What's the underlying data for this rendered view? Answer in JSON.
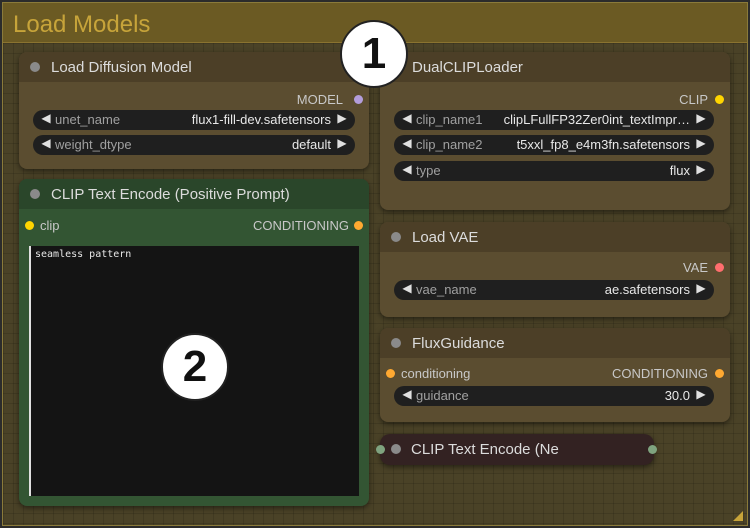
{
  "group": {
    "title": "Load Models"
  },
  "nodes": {
    "load_diffusion": {
      "title": "Load Diffusion Model",
      "output_label": "MODEL",
      "widgets": [
        {
          "label": "unet_name",
          "value": "flux1-fill-dev.safetensors"
        },
        {
          "label": "weight_dtype",
          "value": "default"
        }
      ]
    },
    "dual_clip": {
      "title": "DualCLIPLoader",
      "output_label": "CLIP",
      "widgets": [
        {
          "label": "clip_name1",
          "value": "clipLFullFP32Zer0int_textImpr…"
        },
        {
          "label": "clip_name2",
          "value": "t5xxl_fp8_e4m3fn.safetensors"
        },
        {
          "label": "type",
          "value": "flux"
        }
      ]
    },
    "clip_positive": {
      "title": "CLIP Text Encode (Positive Prompt)",
      "input_label": "clip",
      "output_label": "CONDITIONING",
      "text": "seamless pattern"
    },
    "load_vae": {
      "title": "Load VAE",
      "output_label": "VAE",
      "widgets": [
        {
          "label": "vae_name",
          "value": "ae.safetensors"
        }
      ]
    },
    "flux_guidance": {
      "title": "FluxGuidance",
      "input_label": "conditioning",
      "output_label": "CONDITIONING",
      "widgets": [
        {
          "label": "guidance",
          "value": "30.0"
        }
      ]
    },
    "clip_negative": {
      "title": "CLIP Text Encode (Ne"
    }
  },
  "badges": [
    "1",
    "2"
  ],
  "colors": {
    "model_slot": "#b39ddb",
    "clip_slot": "#ffd500",
    "vae_slot": "#ff6e6e",
    "conditioning_slot": "#ffa931",
    "neg_slot": "#7fa37f",
    "positive_node_bg": "#335533",
    "group_accent": "#c7a43a"
  }
}
